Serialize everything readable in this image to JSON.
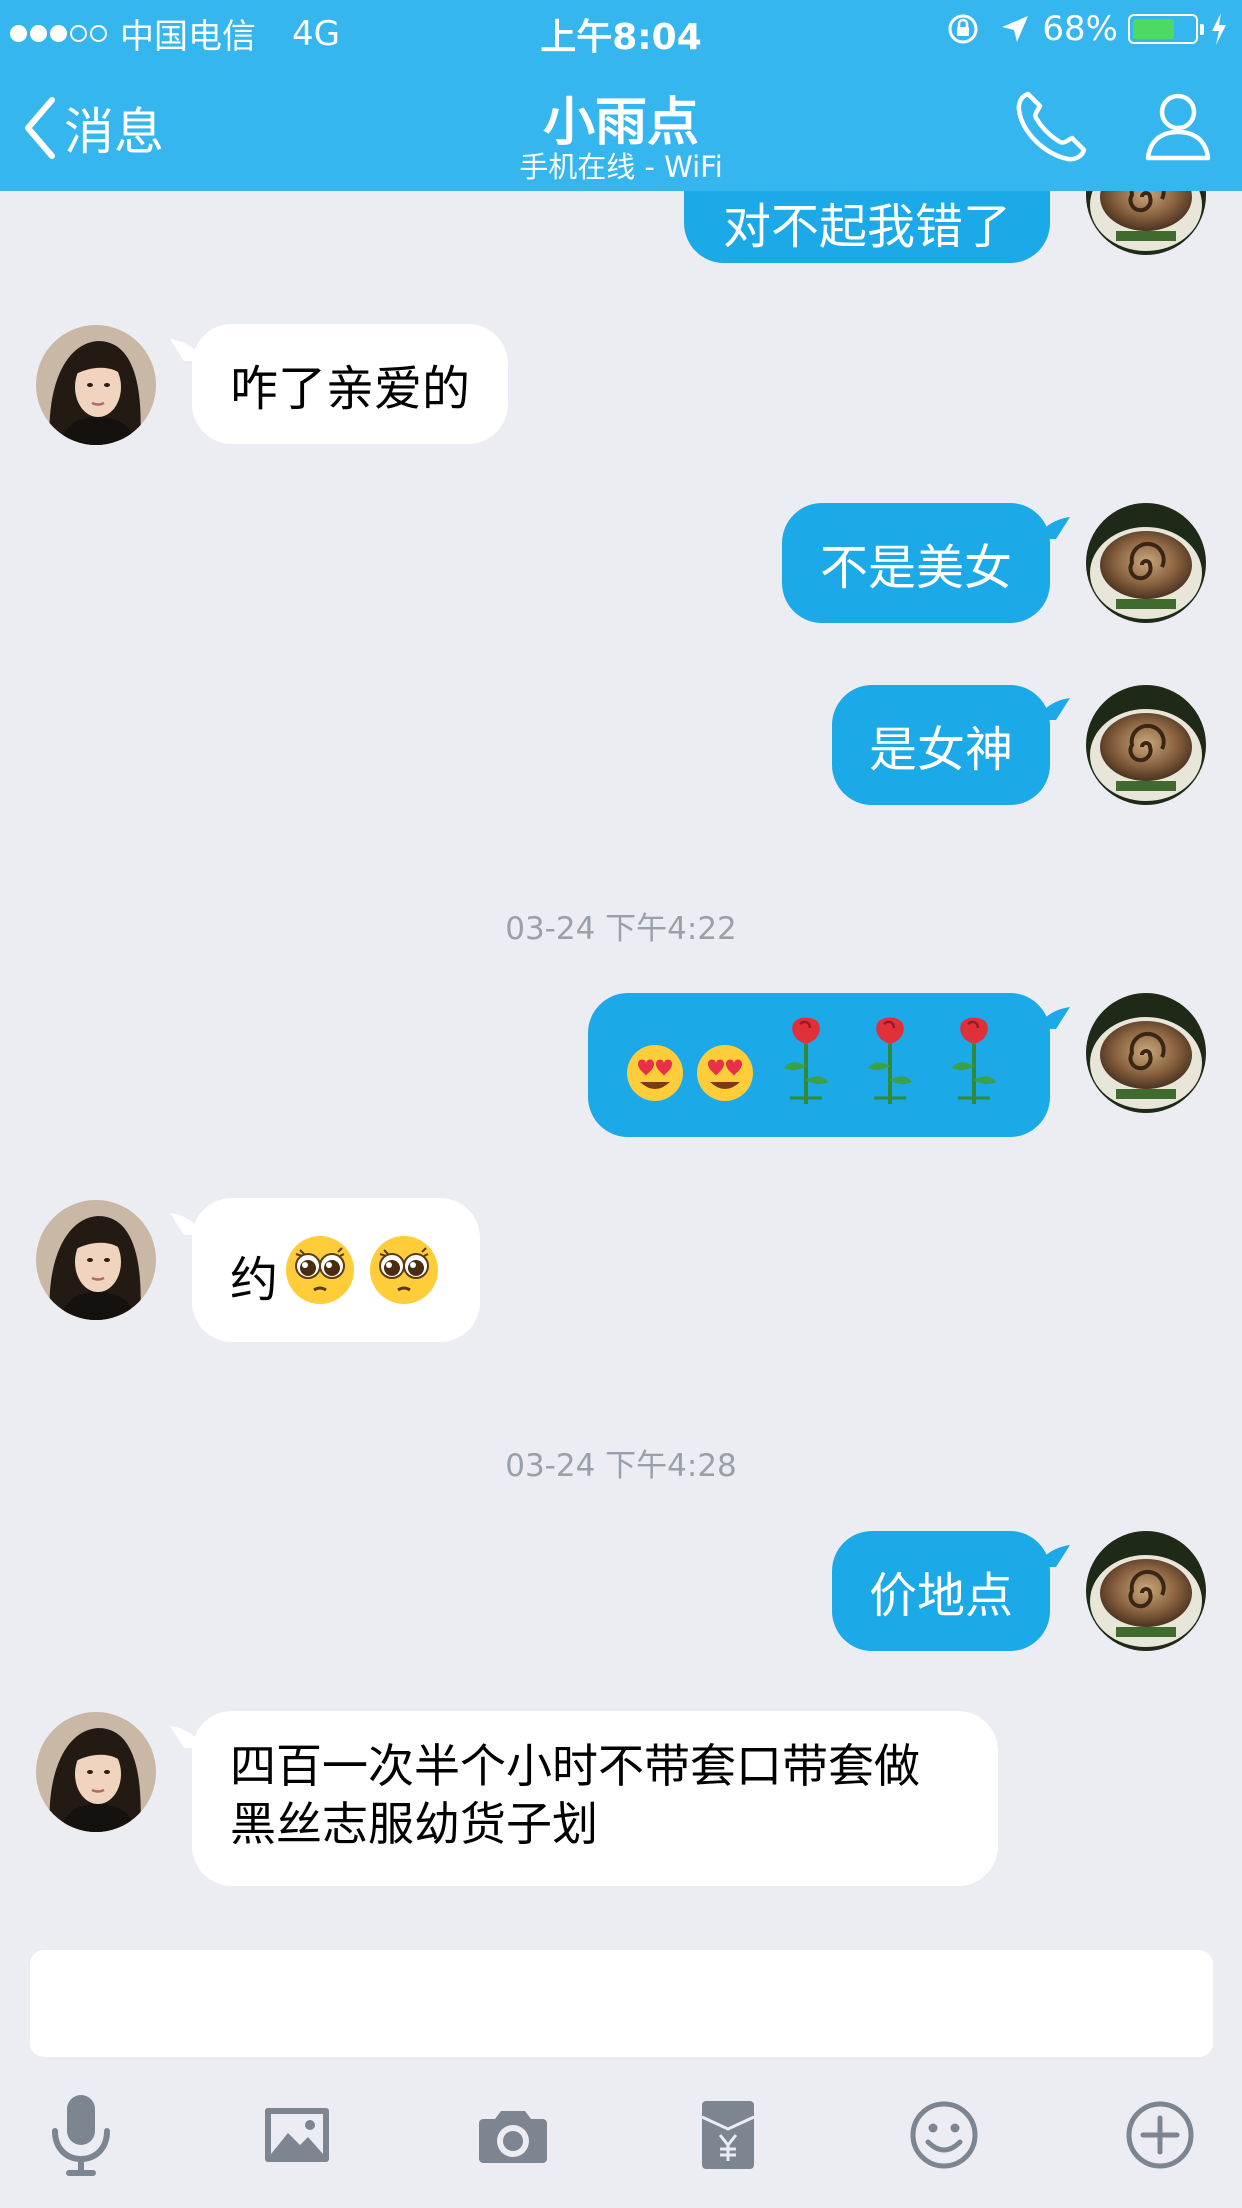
{
  "status_bar": {
    "carrier": "中国电信",
    "network": "4G",
    "time": "上午8:04",
    "battery_percent": "68%",
    "battery_level": 0.68
  },
  "nav": {
    "back_label": "消息",
    "title": "小雨点",
    "subtitle": "手机在线 - WiFi"
  },
  "messages": [
    {
      "direction": "out",
      "text": "对不起我错了"
    },
    {
      "direction": "in",
      "text": "咋了亲爱的"
    },
    {
      "direction": "out",
      "text": "不是美女"
    },
    {
      "direction": "out",
      "text": "是女神"
    },
    {
      "direction": "out",
      "emojis": [
        "heart-eyes-face",
        "heart-eyes-face",
        "rose",
        "rose",
        "rose"
      ]
    },
    {
      "direction": "in",
      "text": "约",
      "emojis": [
        "pleading-face",
        "pleading-face"
      ]
    },
    {
      "direction": "out",
      "text": "价地点"
    },
    {
      "direction": "in",
      "text": "四百一次半个小时不带套口带套做",
      "text2": "黑丝志服幼货子划"
    }
  ],
  "timestamps": [
    "03-24 下午4:22",
    "03-24 下午4:28"
  ],
  "input": {
    "value": "",
    "placeholder": ""
  },
  "toolbar": [
    "microphone-icon",
    "image-icon",
    "camera-icon",
    "red-packet-icon",
    "emoji-icon",
    "plus-icon"
  ],
  "colors": {
    "header": "#35b6ee",
    "outgoing_bubble": "#1ca9e8",
    "incoming_bubble": "#ffffff",
    "chat_background": "#ebedf2",
    "battery": "#4cd964"
  }
}
